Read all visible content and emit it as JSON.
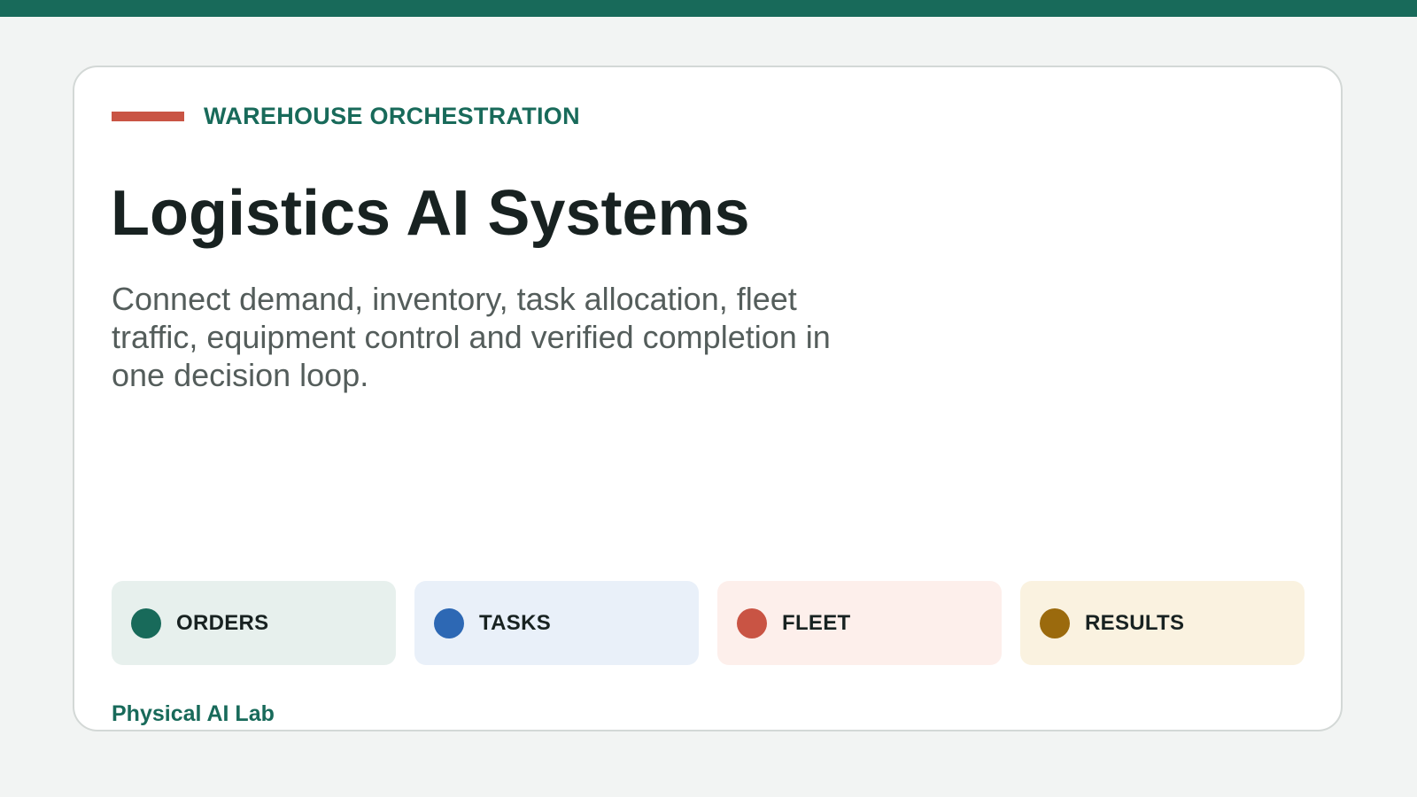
{
  "colors": {
    "accent": "#186a5a",
    "eyebrow_rule": "#c95444",
    "page_background": "#f2f4f3",
    "card_background": "#ffffff",
    "title": "#182221",
    "subtitle": "#545d5b"
  },
  "header": {
    "eyebrow": "WAREHOUSE ORCHESTRATION",
    "title": "Logistics AI Systems",
    "subtitle": "Connect demand, inventory, task allocation, fleet traffic, equipment control and verified completion in one decision loop."
  },
  "stages": [
    {
      "label": "ORDERS",
      "dot_color": "#186a5a",
      "bg_color": "#e7f0ed"
    },
    {
      "label": "TASKS",
      "dot_color": "#2d68b4",
      "bg_color": "#e9f0f9"
    },
    {
      "label": "FLEET",
      "dot_color": "#c95444",
      "bg_color": "#fdefeb"
    },
    {
      "label": "RESULTS",
      "dot_color": "#9b6a0d",
      "bg_color": "#faf2e0"
    }
  ],
  "footer": {
    "brand": "Physical AI Lab"
  }
}
